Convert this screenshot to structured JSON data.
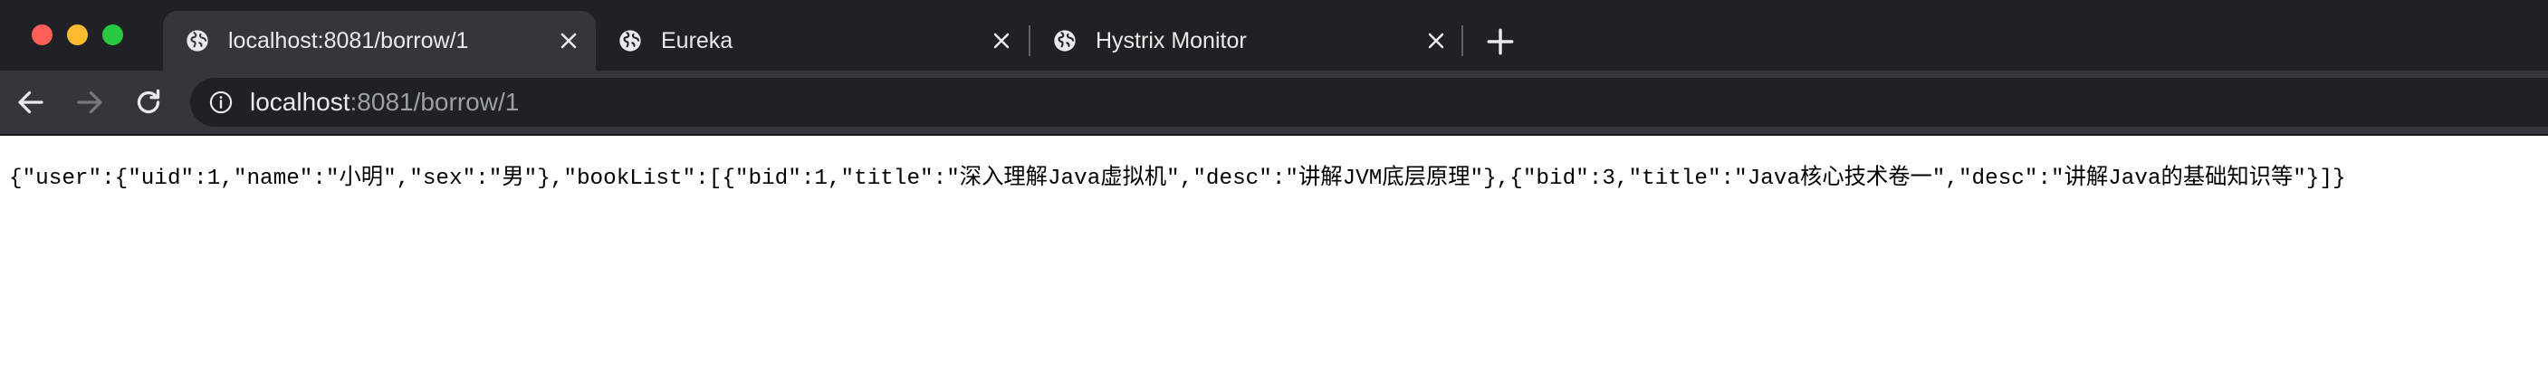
{
  "window": {
    "controls": [
      "close",
      "minimize",
      "maximize"
    ]
  },
  "tabs": [
    {
      "title": "localhost:8081/borrow/1",
      "favicon": "globe-icon",
      "active": true
    },
    {
      "title": "Eureka",
      "favicon": "globe-icon",
      "active": false
    },
    {
      "title": "Hystrix Monitor",
      "favicon": "globe-icon",
      "active": false
    }
  ],
  "toolbar": {
    "back_icon": "arrow-left-icon",
    "forward_icon": "arrow-right-icon",
    "reload_icon": "reload-icon",
    "new_tab_icon": "plus-icon"
  },
  "address_bar": {
    "security_icon": "info-icon",
    "host": "localhost",
    "path": ":8081/borrow/1"
  },
  "page": {
    "body_text": "{\"user\":{\"uid\":1,\"name\":\"小明\",\"sex\":\"男\"},\"bookList\":[{\"bid\":1,\"title\":\"深入理解Java虚拟机\",\"desc\":\"讲解JVM底层原理\"},{\"bid\":3,\"title\":\"Java核心技术卷一\",\"desc\":\"讲解Java的基础知识等\"}]}"
  },
  "colors": {
    "tabstrip_bg": "#202124",
    "active_tab_bg": "#35363a",
    "omnibox_bg": "#202124",
    "text_primary": "#e8eaed",
    "text_secondary": "#9aa0a6",
    "traffic_close": "#ff5f57",
    "traffic_minimize": "#febc2e",
    "traffic_maximize": "#28c840"
  }
}
